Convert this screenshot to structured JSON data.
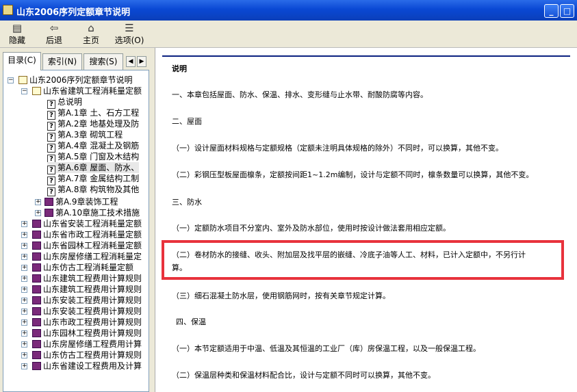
{
  "window": {
    "title": "山东2006序列定额章节说明",
    "min_label": "_",
    "max_label": "□",
    "close_label": "✕"
  },
  "toolbar": {
    "hide": "隐藏",
    "back": "后退",
    "home": "主页",
    "options": "选项(O)"
  },
  "tabs": {
    "contents": "目录(C)",
    "index": "索引(N)",
    "search": "搜索(S)",
    "left_arrow": "◀",
    "right_arrow": "▶"
  },
  "tree": {
    "root": "山东2006序列定额章节说明",
    "level1_open": "山东省建筑工程消耗量定额",
    "items": [
      "总说明",
      "第A.1章 土、石方工程",
      "第A.2章 地基处理及防",
      "第A.3章 砌筑工程",
      "第A.4章 混凝土及钢筋",
      "第A.5章 门窗及木结构",
      "第A.6章 屋面、防水、",
      "第A.7章 金属结构工制",
      "第A.8章 构筑物及其他"
    ],
    "sub_books": [
      "第A.9章装饰工程",
      "第A.10章施工技术措施"
    ],
    "books": [
      "山东省安装工程消耗量定额",
      "山东省市政工程消耗量定额",
      "山东省园林工程消耗量定额",
      "山东房屋修缮工程消耗量定",
      "山东仿古工程消耗量定额",
      "山东建筑工程费用计算规则",
      "山东建筑工程费用计算规则",
      "山东安装工程费用计算规则",
      "山东安装工程费用计算规则",
      "山东市政工程费用计算规则",
      "山东园林工程费用计算规则",
      "山东房屋修缮工程费用计算",
      "山东仿古工程费用计算规则",
      "山东省建设工程费用及计算"
    ]
  },
  "content": {
    "heading": "说明",
    "p1": "一、本章包括屋面、防水、保温、排水、变形缝与止水带、耐酸防腐等内容。",
    "p2": "二、屋面",
    "p3": "（一）设计屋面材料规格与定额规格（定额未注明具体规格的除外）不同时，可以换算，其他不变。",
    "p4": "（二）彩钢压型板屋面檩条，定额按间距1~1.2m编制，设计与定额不同时，檩条数量可以换算，其他不变。",
    "p5": "三、防水",
    "p6": "（一）定额防水项目不分室内、室外及防水部位，使用时按设计做法套用相应定额。",
    "p7a": "（二）卷材防水的接缝、收头、附加层及找平层的嵌缝、冷底子油等人工、材料，已计入定额中，不另行计",
    "p7b": "算。",
    "p8": "（三）细石混凝土防水层，使用钢筋网时，按有关章节规定计算。",
    "p9": "四、保温",
    "p10": "（一）本节定额适用于中温、低温及其恒温的工业厂（库）房保温工程，以及一般保温工程。",
    "p11": "（二）保温层种类和保温材料配合比，设计与定额不同时可以换算，其他不变。"
  },
  "colors": {
    "titlebar": "#0a48d4",
    "highlight_box": "#e8323c",
    "rule_line": "#0a2080"
  }
}
